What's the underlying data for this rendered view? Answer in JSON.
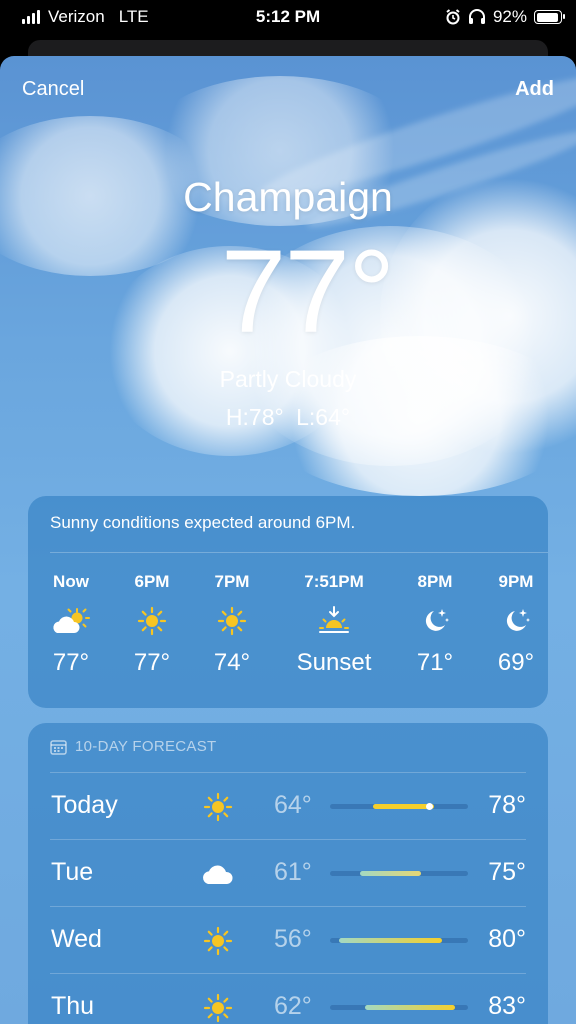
{
  "status_bar": {
    "carrier": "Verizon",
    "network": "LTE",
    "time": "5:12 PM",
    "battery_percent": "92%",
    "battery_level": 0.92
  },
  "header": {
    "cancel_label": "Cancel",
    "add_label": "Add"
  },
  "current": {
    "city": "Champaign",
    "temperature": "77°",
    "condition": "Partly Cloudy",
    "high_low": "H:78° L:64°"
  },
  "hourly": {
    "message": "Sunny conditions expected around 6PM.",
    "hours": [
      {
        "label": "Now",
        "icon": "partly-cloudy-icon",
        "value": "77°"
      },
      {
        "label": "6PM",
        "icon": "sun-icon",
        "value": "77°"
      },
      {
        "label": "7PM",
        "icon": "sun-icon",
        "value": "74°"
      },
      {
        "label": "7:51PM",
        "icon": "sunset-icon",
        "value": "Sunset"
      },
      {
        "label": "8PM",
        "icon": "moon-stars-icon",
        "value": "71°"
      },
      {
        "label": "9PM",
        "icon": "moon-stars-icon",
        "value": "69°"
      }
    ]
  },
  "forecast": {
    "header": "10-DAY FORECAST",
    "range_min": 54,
    "range_max": 86,
    "days": [
      {
        "day": "Today",
        "icon": "sun-icon",
        "low": "64°",
        "high": "78°",
        "low_value": 64,
        "high_value": 78,
        "current_value": 77
      },
      {
        "day": "Tue",
        "icon": "cloud-icon",
        "low": "61°",
        "high": "75°",
        "low_value": 61,
        "high_value": 75
      },
      {
        "day": "Wed",
        "icon": "sun-icon",
        "low": "56°",
        "high": "80°",
        "low_value": 56,
        "high_value": 80
      },
      {
        "day": "Thu",
        "icon": "sun-icon",
        "low": "62°",
        "high": "83°",
        "low_value": 62,
        "high_value": 83
      }
    ]
  },
  "colors": {
    "sun": "#f6c523",
    "bar_warm": "#f5cf2c",
    "bar_cool": "#a3d9c2"
  }
}
